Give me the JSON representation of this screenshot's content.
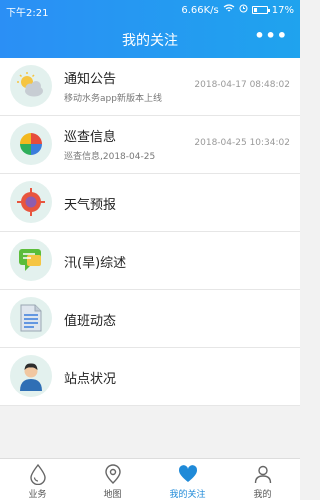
{
  "status": {
    "time": "下午2:21",
    "speed": "6.66K/s",
    "battery": "17%"
  },
  "header": {
    "title": "我的关注",
    "more": "•••"
  },
  "items": [
    {
      "name": "通知公告",
      "sub": "移动水务app新版本上线",
      "date": "2018-04-17 08:48:02",
      "icon": "weather-cloud-sun-icon"
    },
    {
      "name": "巡查信息",
      "sub": "巡查信息,2018-04-25",
      "date": "2018-04-25 10:34:02",
      "icon": "pinwheel-icon"
    },
    {
      "name": "天气预报",
      "icon": "target-icon"
    },
    {
      "name": "汛(旱)综述",
      "icon": "chat-bubble-icon"
    },
    {
      "name": "值班动态",
      "icon": "document-icon"
    },
    {
      "name": "站点状况",
      "icon": "person-icon"
    }
  ],
  "tabs": [
    {
      "label": "业务",
      "icon": "drop-icon"
    },
    {
      "label": "地图",
      "icon": "map-pin-icon"
    },
    {
      "label": "我的关注",
      "icon": "heart-icon",
      "active": true
    },
    {
      "label": "我的",
      "icon": "user-icon"
    }
  ],
  "colors": {
    "accent": "#1f8ad8",
    "header": "#2b8ff5"
  }
}
